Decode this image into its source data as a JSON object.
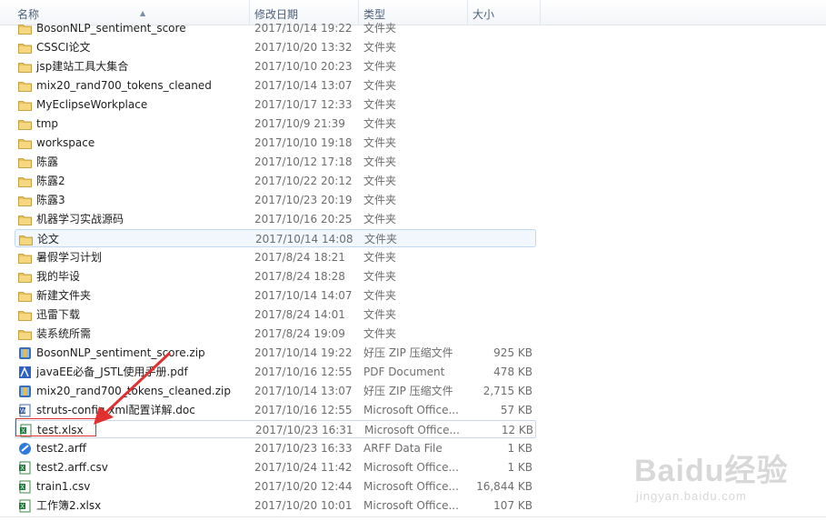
{
  "columns": {
    "name": "名称",
    "date": "修改日期",
    "type": "类型",
    "size": "大小"
  },
  "files": [
    {
      "name": "BosonNLP_sentiment_score",
      "date": "2017/10/14 19:22",
      "type": "文件夹",
      "size": "",
      "icon": "folder-icon"
    },
    {
      "name": "CSSCI论文",
      "date": "2017/10/20 13:32",
      "type": "文件夹",
      "size": "",
      "icon": "folder-icon"
    },
    {
      "name": "jsp建站工具大集合",
      "date": "2017/10/10 20:23",
      "type": "文件夹",
      "size": "",
      "icon": "folder-icon"
    },
    {
      "name": "mix20_rand700_tokens_cleaned",
      "date": "2017/10/14 13:07",
      "type": "文件夹",
      "size": "",
      "icon": "folder-icon"
    },
    {
      "name": "MyEclipseWorkplace",
      "date": "2017/10/17 12:33",
      "type": "文件夹",
      "size": "",
      "icon": "folder-icon"
    },
    {
      "name": "tmp",
      "date": "2017/10/9 21:39",
      "type": "文件夹",
      "size": "",
      "icon": "folder-icon"
    },
    {
      "name": "workspace",
      "date": "2017/10/10 19:18",
      "type": "文件夹",
      "size": "",
      "icon": "folder-icon"
    },
    {
      "name": "陈露",
      "date": "2017/10/12 17:18",
      "type": "文件夹",
      "size": "",
      "icon": "folder-icon"
    },
    {
      "name": "陈露2",
      "date": "2017/10/22 20:12",
      "type": "文件夹",
      "size": "",
      "icon": "folder-icon"
    },
    {
      "name": "陈露3",
      "date": "2017/10/23 20:19",
      "type": "文件夹",
      "size": "",
      "icon": "folder-icon"
    },
    {
      "name": "机器学习实战源码",
      "date": "2017/10/16 20:25",
      "type": "文件夹",
      "size": "",
      "icon": "folder-icon"
    },
    {
      "name": "论文",
      "date": "2017/10/14 14:08",
      "type": "文件夹",
      "size": "",
      "icon": "folder-icon"
    },
    {
      "name": "暑假学习计划",
      "date": "2017/8/24 18:21",
      "type": "文件夹",
      "size": "",
      "icon": "folder-icon"
    },
    {
      "name": "我的毕设",
      "date": "2017/8/24 18:28",
      "type": "文件夹",
      "size": "",
      "icon": "folder-icon"
    },
    {
      "name": "新建文件夹",
      "date": "2017/10/14 14:07",
      "type": "文件夹",
      "size": "",
      "icon": "folder-icon"
    },
    {
      "name": "迅雷下载",
      "date": "2017/8/24 14:01",
      "type": "文件夹",
      "size": "",
      "icon": "folder-icon"
    },
    {
      "name": "装系统所需",
      "date": "2017/8/24 19:09",
      "type": "文件夹",
      "size": "",
      "icon": "folder-icon"
    },
    {
      "name": "BosonNLP_sentiment_score.zip",
      "date": "2017/10/14 19:22",
      "type": "好压 ZIP 压缩文件",
      "size": "925 KB",
      "icon": "zip-icon"
    },
    {
      "name": "javaEE必备_JSTL使用手册.pdf",
      "date": "2017/10/16 12:55",
      "type": "PDF Document",
      "size": "478 KB",
      "icon": "pdf-icon"
    },
    {
      "name": "mix20_rand700_tokens_cleaned.zip",
      "date": "2017/10/14 13:07",
      "type": "好压 ZIP 压缩文件",
      "size": "2,715 KB",
      "icon": "zip-icon"
    },
    {
      "name": "struts-config.xml配置详解.doc",
      "date": "2017/10/16 12:55",
      "type": "Microsoft Office...",
      "size": "57 KB",
      "icon": "word-icon"
    },
    {
      "name": "test.xlsx",
      "date": "2017/10/23 16:31",
      "type": "Microsoft Office...",
      "size": "12 KB",
      "icon": "excel-icon"
    },
    {
      "name": "test2.arff",
      "date": "2017/10/23 16:33",
      "type": "ARFF Data File",
      "size": "1 KB",
      "icon": "arff-icon"
    },
    {
      "name": "test2.arff.csv",
      "date": "2017/10/24 11:42",
      "type": "Microsoft Office...",
      "size": "1 KB",
      "icon": "excel-icon"
    },
    {
      "name": "train1.csv",
      "date": "2017/10/20 12:44",
      "type": "Microsoft Office...",
      "size": "16,844 KB",
      "icon": "excel-icon"
    },
    {
      "name": "工作簿2.xlsx",
      "date": "2017/10/20 10:01",
      "type": "Microsoft Office...",
      "size": "107 KB",
      "icon": "excel-icon"
    }
  ],
  "watermark": {
    "logo": "Baidu经验",
    "sub": "jingyan.baidu.com"
  },
  "colors": {
    "hover_border": "#c0d8f1",
    "hover_bg": "#f2f7fd",
    "annotation_red": "#e03030",
    "folder": "#e8c25a"
  }
}
